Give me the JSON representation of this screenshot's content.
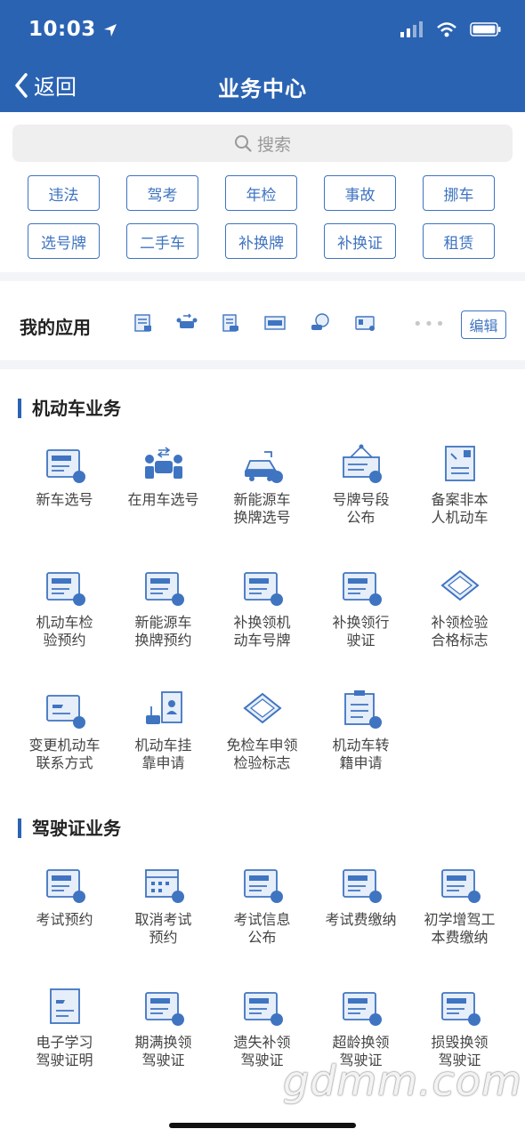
{
  "status_bar": {
    "time": "10:03"
  },
  "nav": {
    "back_label": "返回",
    "title": "业务中心"
  },
  "search": {
    "placeholder": "搜索"
  },
  "quick_tags": [
    "违法",
    "驾考",
    "年检",
    "事故",
    "挪车",
    "选号牌",
    "二手车",
    "补换牌",
    "补换证",
    "租赁"
  ],
  "my_apps": {
    "title": "我的应用",
    "icons": [
      "plate-select-icon",
      "car-swap-icon",
      "doc-car-icon",
      "plate-board-icon",
      "car-chat-icon",
      "license-card-icon"
    ],
    "edit_label": "编辑"
  },
  "vehicle_section": {
    "title": "机动车业务",
    "items": [
      {
        "label": "新车选号",
        "icon": "new-plate-icon"
      },
      {
        "label": "在用车选号",
        "icon": "car-swap-icon"
      },
      {
        "label": "新能源车\n换牌选号",
        "icon": "ev-car-icon"
      },
      {
        "label": "号牌号段\n公布",
        "icon": "sign-board-icon"
      },
      {
        "label": "备案非本\n人机动车",
        "icon": "record-doc-icon"
      },
      {
        "label": "机动车检\n验预约",
        "icon": "inspect-book-icon"
      },
      {
        "label": "新能源车\n换牌预约",
        "icon": "ev-plate-book-icon"
      },
      {
        "label": "补换领机\n动车号牌",
        "icon": "plate-reissue-icon"
      },
      {
        "label": "补换领行\n驶证",
        "icon": "license-reissue-icon"
      },
      {
        "label": "补领检验\n合格标志",
        "icon": "inspect-mark-icon"
      },
      {
        "label": "变更机动车\n联系方式",
        "icon": "contact-change-icon"
      },
      {
        "label": "机动车挂\n靠申请",
        "icon": "affiliate-icon"
      },
      {
        "label": "免检车申领\n检验标志",
        "icon": "exempt-mark-icon"
      },
      {
        "label": "机动车转\n籍申请",
        "icon": "transfer-icon"
      }
    ]
  },
  "license_section": {
    "title": "驾驶证业务",
    "items": [
      {
        "label": "考试预约",
        "icon": "exam-book-icon"
      },
      {
        "label": "取消考试\n预约",
        "icon": "exam-cancel-icon"
      },
      {
        "label": "考试信息\n公布",
        "icon": "exam-info-icon"
      },
      {
        "label": "考试费缴纳",
        "icon": "exam-fee-icon"
      },
      {
        "label": "初学增驾工\n本费缴纳",
        "icon": "learner-fee-icon"
      },
      {
        "label": "电子学习\n驾驶证明",
        "icon": "learn-cert-icon"
      },
      {
        "label": "期满换领\n驾驶证",
        "icon": "expire-renew-icon"
      },
      {
        "label": "遗失补领\n驾驶证",
        "icon": "lost-reissue-icon"
      },
      {
        "label": "超龄换领\n驾驶证",
        "icon": "overage-renew-icon"
      },
      {
        "label": "损毁换领\n驾驶证",
        "icon": "damaged-renew-icon"
      }
    ]
  },
  "watermark": "gdmm.com",
  "colors": {
    "primary": "#2b63b3",
    "accent": "#3f74c1",
    "icon_bg": "#e6eef9"
  }
}
